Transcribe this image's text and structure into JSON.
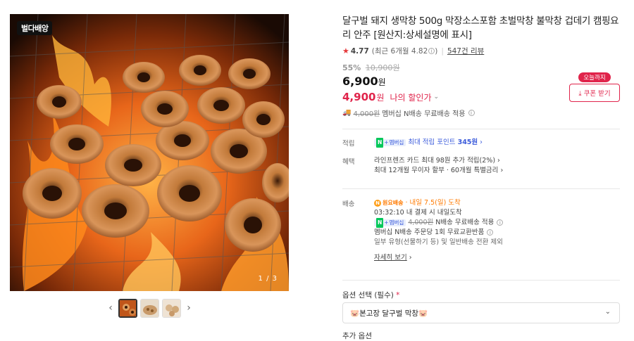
{
  "product": {
    "title": "달구벌 돼지 생막창 500g 막장소스포함 초벌막창 불막창 겁데기 캠핑요리 안주 [원산지:상세설명에 표시]",
    "brand_badge": "벌다배앙",
    "image_counter": "1 / 3",
    "rating": "4.77",
    "recent_rating": "(최근 6개월 4.82",
    "recent_rating_close": ")",
    "review_count": "547건 리뷰"
  },
  "price": {
    "discount_rate": "55%",
    "original_price": "10,900원",
    "sale_price": "6,900",
    "won": "원",
    "member_price": "4,900",
    "my_discount": "나의 할인가",
    "shipping_note_strike": "4,000원",
    "shipping_note": "멤버십 N배송 무료배송 적용"
  },
  "coupon": {
    "tag": "오늘까지",
    "button": "쿠폰 받기"
  },
  "details": {
    "points_label": "적립",
    "points_badge": "멤버십",
    "points_text": "최대 적립 포인트",
    "points_value": "345원",
    "benefit_label": "혜택",
    "benefit_line1": "라인프렌즈 카드 최대 98원 추가 적립(2%)",
    "benefit_line2": "최대 12개월 무이자 할부 · 60개월 특별금리",
    "shipping_label": "배송",
    "arrival_badge": "원요배송",
    "arrival_text": "· 내일 7.5(일) 도착",
    "arrival_time": "03:32:10",
    "arrival_time_suffix": " 내 결제 시 내일도착",
    "free_ship_strike": "4,000원",
    "free_ship_text": "N배송 무료배송 적용",
    "return_text": "멤버십 N배송 주문당 1회 무료교환반품",
    "exclude_text": "일부 유형(선물하기 등) 및 일반배송 전환 제외",
    "more_link": "자세히 보기"
  },
  "option": {
    "label": "옵션 선택 (필수)",
    "required_mark": "*",
    "selected": "🐷본고장 달구벌 막창🐷",
    "add_label": "추가 옵션"
  }
}
